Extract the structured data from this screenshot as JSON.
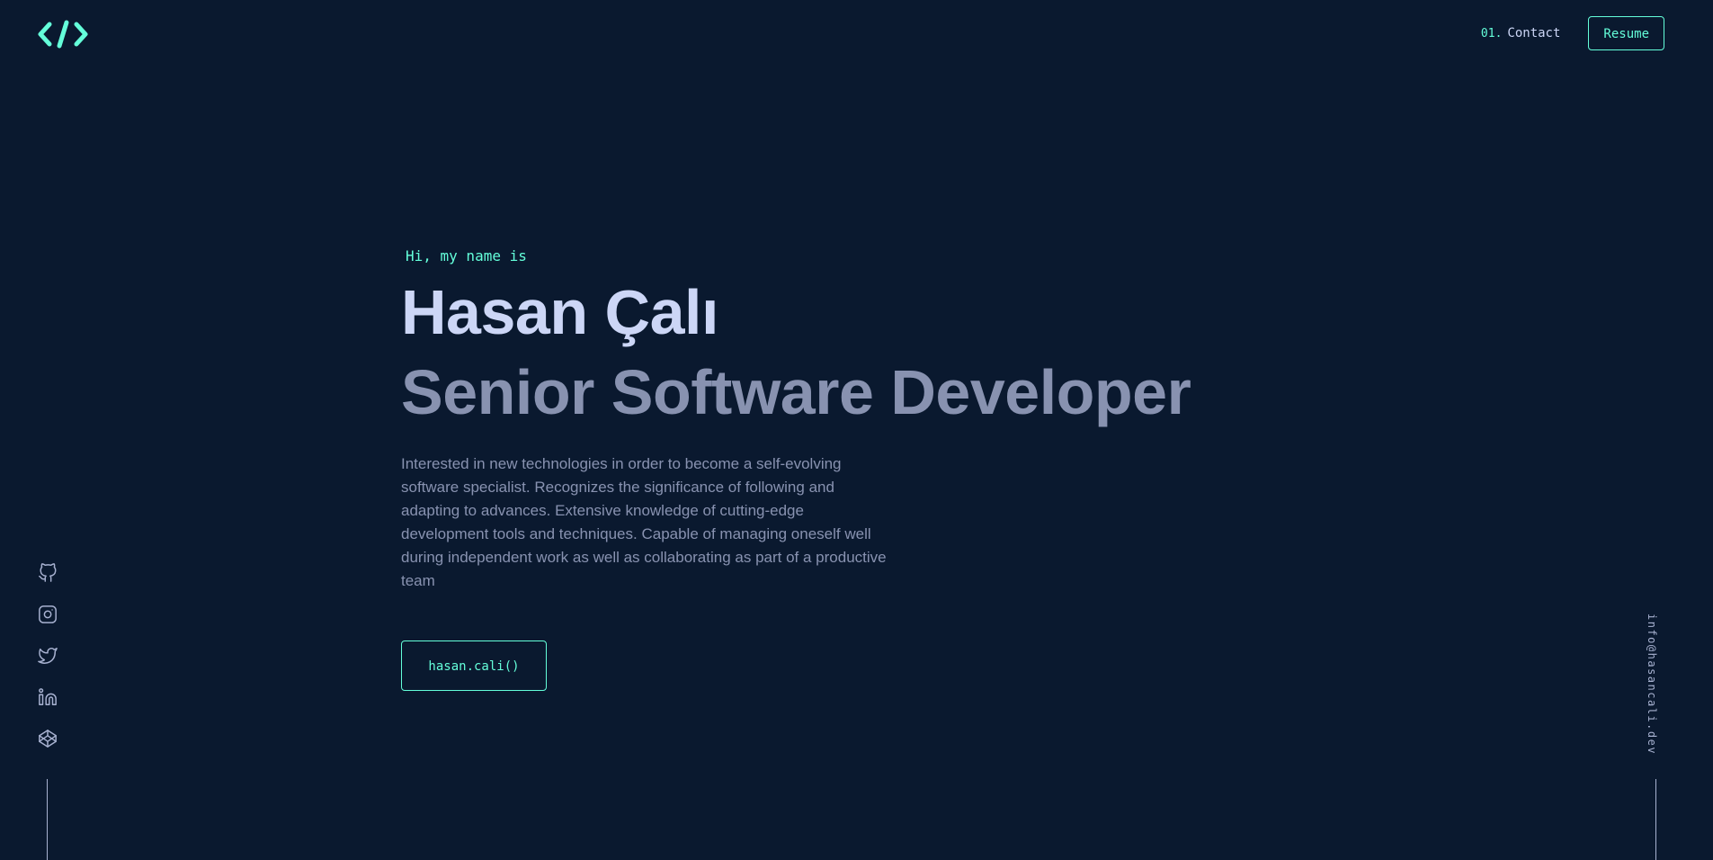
{
  "header": {
    "logo_icon": "code-brackets-icon",
    "nav_items": [
      {
        "number": "01.",
        "label": "Contact"
      }
    ],
    "resume_label": "Resume"
  },
  "hero": {
    "greeting": "Hi, my name is",
    "name": "Hasan Çalı",
    "title": "Senior Software Developer",
    "bio": "Interested in new technologies in order to become a self-evolving software specialist. Recognizes the significance of following and adapting to advances. Extensive knowledge of cutting-edge development tools and techniques. Capable of managing oneself well during independent work as well as collaborating as part of a productive team",
    "cta_label": "hasan.cali()"
  },
  "social_links": [
    "github-icon",
    "instagram-icon",
    "twitter-icon",
    "linkedin-icon",
    "codepen-icon"
  ],
  "email": "info@hasancali.dev",
  "colors": {
    "background": "#0a192f",
    "accent": "#64ffda",
    "heading": "#ccd6f6",
    "text": "#8892b0"
  }
}
